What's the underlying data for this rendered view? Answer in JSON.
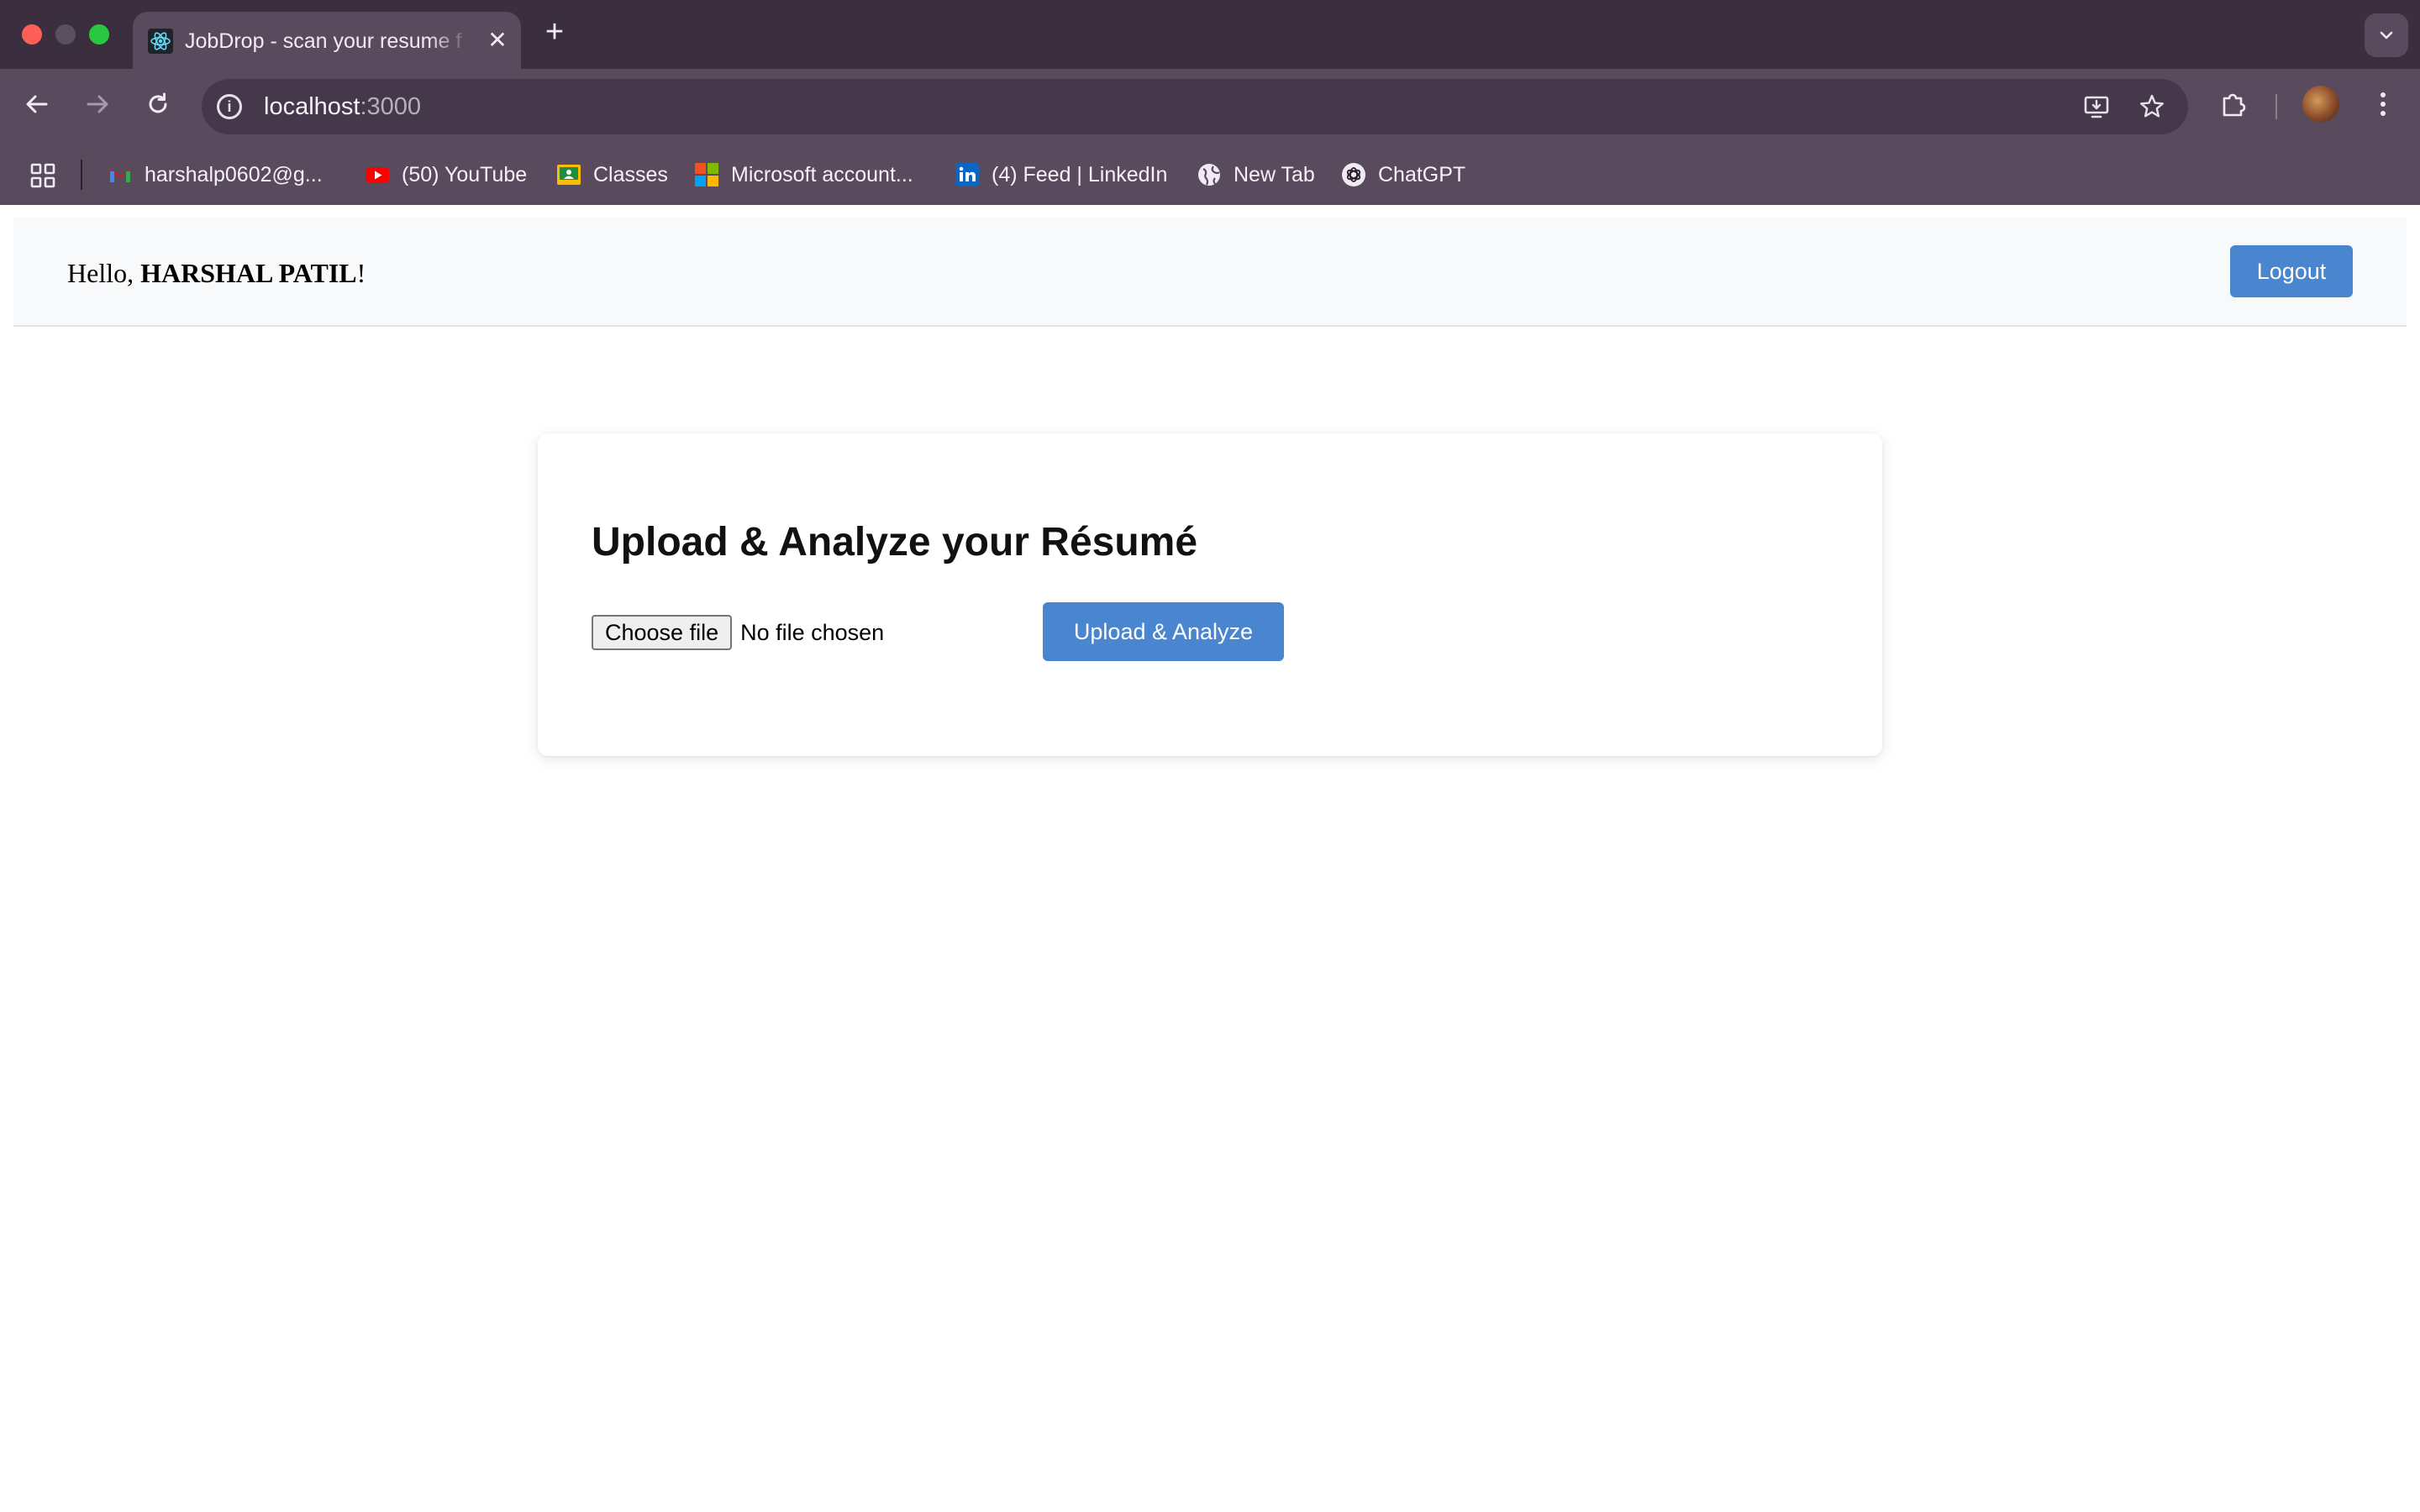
{
  "browser": {
    "tab_title": "JobDrop - scan your resume f",
    "tab_close": "✕",
    "new_tab": "+",
    "url_host": "localhost",
    "url_port": ":3000",
    "bookmarks": [
      {
        "label": "harshalp0602@g...",
        "icon": "gmail-icon"
      },
      {
        "label": "(50) YouTube",
        "icon": "youtube-icon"
      },
      {
        "label": "Classes",
        "icon": "classroom-icon"
      },
      {
        "label": "Microsoft account...",
        "icon": "microsoft-icon"
      },
      {
        "label": "(4) Feed | LinkedIn",
        "icon": "linkedin-icon"
      },
      {
        "label": "New Tab",
        "icon": "globe-icon"
      },
      {
        "label": "ChatGPT",
        "icon": "chatgpt-icon"
      }
    ]
  },
  "header": {
    "greeting_prefix": "Hello, ",
    "user_name": "HARSHAL PATIL",
    "greeting_suffix": "!",
    "logout_label": "Logout"
  },
  "upload": {
    "title": "Upload & Analyze your Résumé",
    "choose_file_label": "Choose file",
    "file_status": "No file chosen",
    "submit_label": "Upload & Analyze"
  },
  "colors": {
    "primary_button": "#4a86cf",
    "header_background": "#f8f9fa",
    "browser_frame": "#3b2f3f"
  }
}
